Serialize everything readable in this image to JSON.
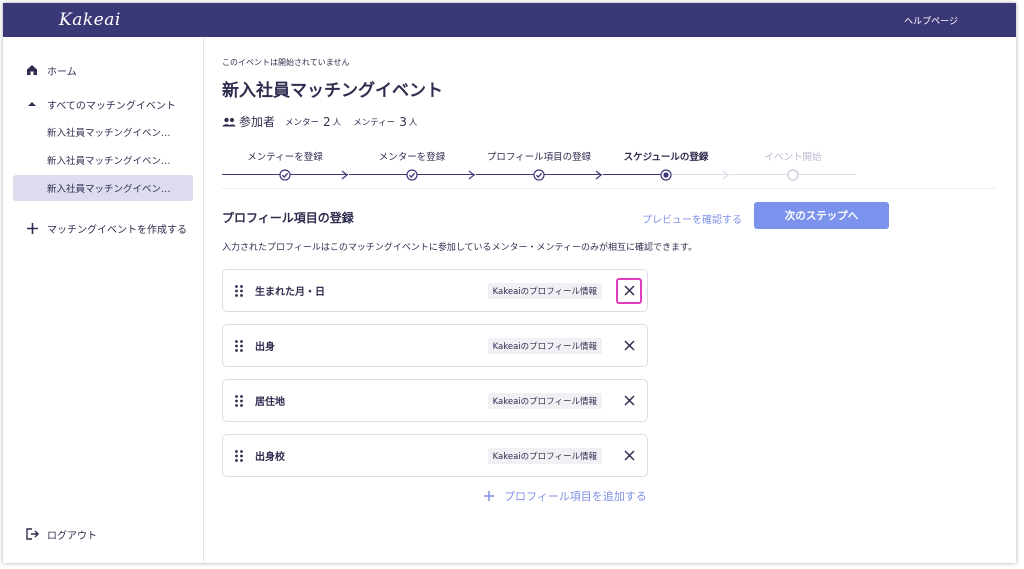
{
  "header": {
    "logo": "Kakeai",
    "help_link": "ヘルプページ"
  },
  "sidebar": {
    "home": "ホーム",
    "all_events": "すべてのマッチングイベント",
    "events": [
      "新入社員マッチングイベン…",
      "新入社員マッチングイベン…",
      "新入社員マッチングイベン…"
    ],
    "create_event": "マッチングイベントを作成する",
    "logout": "ログアウト"
  },
  "main": {
    "status_note": "このイベントは開始されていません",
    "event_title": "新入社員マッチングイベント",
    "participants": {
      "title": "参加者",
      "mentor_label": "メンター",
      "mentor_count": "2",
      "mentor_unit": "人",
      "mentee_label": "メンティー",
      "mentee_count": "3",
      "mentee_unit": "人"
    },
    "steps": [
      {
        "label": "メンティーを登録",
        "state": "done"
      },
      {
        "label": "メンターを登録",
        "state": "done"
      },
      {
        "label": "プロフィール項目の登録",
        "state": "done"
      },
      {
        "label": "スケジュールの登録",
        "state": "current"
      },
      {
        "label": "イベント開始",
        "state": "future"
      }
    ],
    "section_title": "プロフィール項目の登録",
    "preview_link": "プレビューを確認する",
    "next_button": "次のステップへ",
    "description": "入力されたプロフィールはこのマッチングイベントに参加しているメンター・メンティーのみが相互に確認できます。",
    "fields": [
      {
        "name": "生まれた月・日",
        "source": "Kakeaiのプロフィール情報"
      },
      {
        "name": "出身",
        "source": "Kakeaiのプロフィール情報"
      },
      {
        "name": "居住地",
        "source": "Kakeaiのプロフィール情報"
      },
      {
        "name": "出身校",
        "source": "Kakeaiのプロフィール情報"
      }
    ],
    "add_field": "プロフィール項目を追加する"
  },
  "colors": {
    "header_bg": "#3b3878",
    "accent": "#7c93ed",
    "highlight": "#e23dbd",
    "active_nav": "#dcdcee"
  }
}
